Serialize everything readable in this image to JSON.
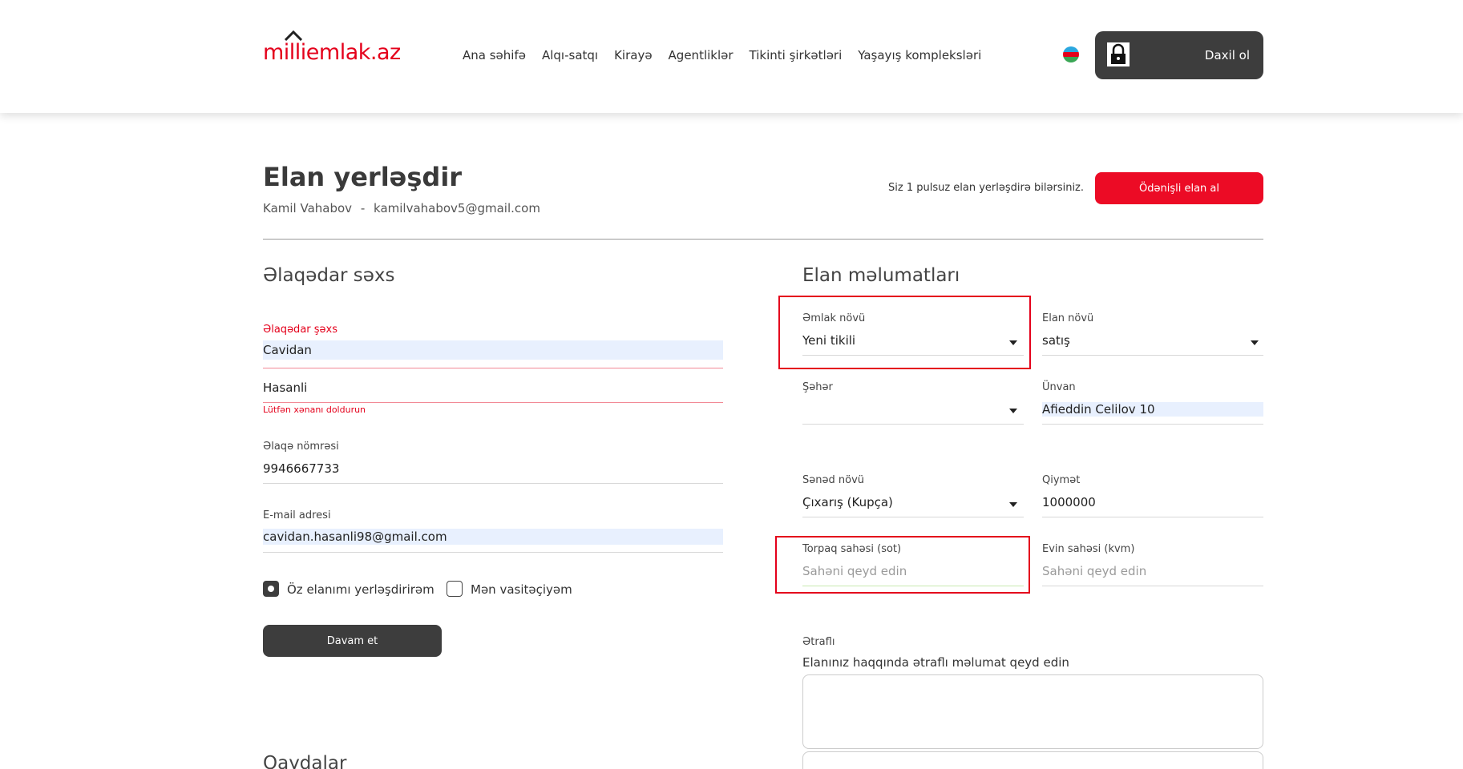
{
  "header": {
    "logo_text": "milliemlak.az",
    "nav": [
      "Ana səhifə",
      "Alqı-satqı",
      "Kirayə",
      "Agentliklər",
      "Tikinti şirkətləri",
      "Yaşayış kompleksləri"
    ],
    "login_label": "Daxil ol",
    "language_flag": "azerbaijan-flag"
  },
  "page": {
    "title": "Elan yerləşdir",
    "user_name": "Kamil Vahabov",
    "user_sep": "-",
    "user_email": "kamilvahabov5@gmail.com",
    "free_note": "Siz 1 pulsuz elan yerləşdirə bilərsiniz.",
    "paid_button": "Ödənişli elan al"
  },
  "contact": {
    "section_title": "Əlaqədar səxs",
    "person_label": "Əlaqədar şəxs",
    "first_name": "Cavidan",
    "last_name": "Hasanli",
    "error_msg": "Lütfən xənanı doldurun",
    "phone_label": "Əlaqə nömrəsi",
    "phone": "9946667733",
    "email_label": "E-mail adresi",
    "email": "cavidan.hasanli98@gmail.com",
    "radio_own": "Öz elanımı yerləşdirirəm",
    "radio_agent": "Mən vasitəçiyəm",
    "continue_button": "Davam et",
    "rules_title": "Qaydalar"
  },
  "listing": {
    "section_title": "Elan məlumatları",
    "property_type_label": "Əmlak növü",
    "property_type": "Yeni tikili",
    "listing_type_label": "Elan növü",
    "listing_type": "satış",
    "city_label": "Şəhər",
    "city": "",
    "address_label": "Ünvan",
    "address": "Afieddin Celilov 10",
    "document_label": "Sənəd növü",
    "document": "Çıxarış (Kupça)",
    "price_label": "Qiymət",
    "price": "1000000",
    "land_area_label": "Torpaq sahəsi (sot)",
    "land_area_placeholder": "Sahəni qeyd edin",
    "house_area_label": "Evin sahəsi (kvm)",
    "house_area_placeholder": "Sahəni qeyd edin",
    "details_label": "Ətraflı",
    "details_hint": "Elanınız haqqında ətraflı məlumat qeyd edin"
  }
}
